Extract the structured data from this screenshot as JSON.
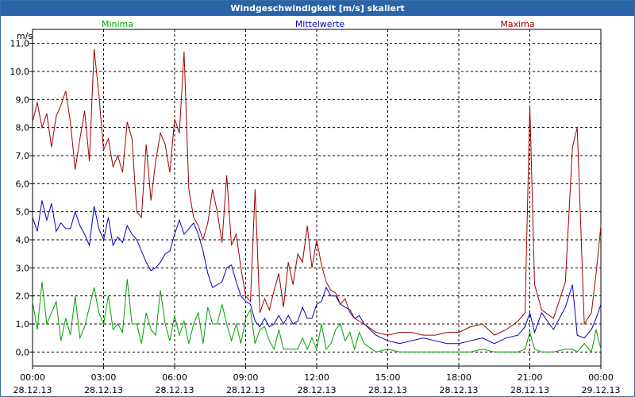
{
  "window": {
    "title": "Windgeschwindigkeit [m/s] skaliert"
  },
  "chart_data": {
    "type": "line",
    "title": "Windgeschwindigkeit [m/s] skaliert",
    "ylabel": "m/s",
    "xlabel": "",
    "ylim": [
      -0.5,
      11.5
    ],
    "xlim": [
      0,
      24
    ],
    "grid": true,
    "legend_position": "top",
    "y_ticks": [
      "0,0",
      "1,0",
      "2,0",
      "3,0",
      "4,0",
      "5,0",
      "6,0",
      "7,0",
      "8,0",
      "9,0",
      "10,0",
      "11,0"
    ],
    "x_ticks": [
      {
        "time": "00:00",
        "date": "28.12.13"
      },
      {
        "time": "03:00",
        "date": "28.12.13"
      },
      {
        "time": "06:00",
        "date": "28.12.13"
      },
      {
        "time": "09:00",
        "date": "28.12.13"
      },
      {
        "time": "12:00",
        "date": "28.12.13"
      },
      {
        "time": "15:00",
        "date": "28.12.13"
      },
      {
        "time": "18:00",
        "date": "28.12.13"
      },
      {
        "time": "21:00",
        "date": "28.12.13"
      },
      {
        "time": "00:00",
        "date": "29.12.13"
      }
    ],
    "series": [
      {
        "name": "Minima",
        "color": "#00a000",
        "x": [
          0,
          0.2,
          0.4,
          0.6,
          0.8,
          1.0,
          1.2,
          1.4,
          1.6,
          1.8,
          2.0,
          2.2,
          2.4,
          2.6,
          2.8,
          3.0,
          3.2,
          3.4,
          3.6,
          3.8,
          4.0,
          4.2,
          4.4,
          4.6,
          4.8,
          5.0,
          5.2,
          5.4,
          5.6,
          5.8,
          6.0,
          6.2,
          6.4,
          6.6,
          6.8,
          7.0,
          7.2,
          7.4,
          7.6,
          7.8,
          8.0,
          8.2,
          8.4,
          8.6,
          8.8,
          9.0,
          9.2,
          9.4,
          9.6,
          9.8,
          10.0,
          10.2,
          10.4,
          10.6,
          10.8,
          11.0,
          11.2,
          11.4,
          11.6,
          11.8,
          12.0,
          12.2,
          12.4,
          12.6,
          12.8,
          13.0,
          13.2,
          13.4,
          13.6,
          13.8,
          14.0,
          14.5,
          15.0,
          15.5,
          16.0,
          16.5,
          17.0,
          17.5,
          18.0,
          18.5,
          19.0,
          19.5,
          20.0,
          20.5,
          20.8,
          21.0,
          21.2,
          21.5,
          22.0,
          22.5,
          22.8,
          23.0,
          23.3,
          23.6,
          23.8,
          24.0
        ],
        "values": [
          1.8,
          0.8,
          2.5,
          1.0,
          1.4,
          1.8,
          0.4,
          1.2,
          0.6,
          2.0,
          0.5,
          0.9,
          1.6,
          2.3,
          1.4,
          1.0,
          2.0,
          0.8,
          1.0,
          0.7,
          2.6,
          1.0,
          1.0,
          0.3,
          1.4,
          0.8,
          0.6,
          2.2,
          1.0,
          0.4,
          1.3,
          0.6,
          1.1,
          0.3,
          1.0,
          1.4,
          0.3,
          1.6,
          1.0,
          1.0,
          1.7,
          1.0,
          0.4,
          1.0,
          0.3,
          1.2,
          1.5,
          0.3,
          0.8,
          0.9,
          0.4,
          0.1,
          0.8,
          0.1,
          0.1,
          0.1,
          0.1,
          0.5,
          0.1,
          0.5,
          0.1,
          1.0,
          0.1,
          0.3,
          0.8,
          1.0,
          0.4,
          0.7,
          0.1,
          0.7,
          0.3,
          0.0,
          0.1,
          0.0,
          0.0,
          0.0,
          0.0,
          0.0,
          0.0,
          0.0,
          0.1,
          0.0,
          0.0,
          0.0,
          0.1,
          0.7,
          0.1,
          0.0,
          0.0,
          0.1,
          0.1,
          0.0,
          0.3,
          0.0,
          0.8,
          0.1
        ]
      },
      {
        "name": "Mittelwerte",
        "color": "#0000c0",
        "x": [
          0,
          0.2,
          0.4,
          0.6,
          0.8,
          1.0,
          1.2,
          1.4,
          1.6,
          1.8,
          2.0,
          2.2,
          2.4,
          2.6,
          2.8,
          3.0,
          3.2,
          3.4,
          3.6,
          3.8,
          4.0,
          4.2,
          4.4,
          4.6,
          4.8,
          5.0,
          5.2,
          5.4,
          5.6,
          5.8,
          6.0,
          6.2,
          6.4,
          6.6,
          6.8,
          7.0,
          7.2,
          7.4,
          7.6,
          7.8,
          8.0,
          8.2,
          8.4,
          8.6,
          8.8,
          9.0,
          9.2,
          9.4,
          9.6,
          9.8,
          10.0,
          10.2,
          10.4,
          10.6,
          10.8,
          11.0,
          11.2,
          11.4,
          11.6,
          11.8,
          12.0,
          12.2,
          12.4,
          12.6,
          12.8,
          13.0,
          13.2,
          13.4,
          13.6,
          13.8,
          14.0,
          14.5,
          15.0,
          15.5,
          16.0,
          16.5,
          17.0,
          17.5,
          18.0,
          18.5,
          19.0,
          19.5,
          20.0,
          20.5,
          20.8,
          21.0,
          21.2,
          21.5,
          22.0,
          22.5,
          22.8,
          23.0,
          23.3,
          23.6,
          23.8,
          24.0
        ],
        "values": [
          4.8,
          4.3,
          5.4,
          4.7,
          5.3,
          4.3,
          4.6,
          4.4,
          4.4,
          5.0,
          4.5,
          4.2,
          3.8,
          5.2,
          4.4,
          4.0,
          4.8,
          3.8,
          4.1,
          3.9,
          4.5,
          4.2,
          4.0,
          3.6,
          3.2,
          2.9,
          3.0,
          3.2,
          3.5,
          3.6,
          4.2,
          4.7,
          4.2,
          4.4,
          4.6,
          4.2,
          3.6,
          2.8,
          2.3,
          2.4,
          2.5,
          3.0,
          3.1,
          2.5,
          2.0,
          1.8,
          1.7,
          1.1,
          0.9,
          1.2,
          0.9,
          1.0,
          1.3,
          1.0,
          1.3,
          1.0,
          1.1,
          1.6,
          1.2,
          1.2,
          1.7,
          1.8,
          2.3,
          2.0,
          2.0,
          1.7,
          1.6,
          1.5,
          1.2,
          1.3,
          1.0,
          0.6,
          0.4,
          0.3,
          0.4,
          0.5,
          0.4,
          0.3,
          0.3,
          0.4,
          0.5,
          0.3,
          0.5,
          0.6,
          0.9,
          1.4,
          0.7,
          1.4,
          0.8,
          1.6,
          2.4,
          0.6,
          0.5,
          0.8,
          1.2,
          1.7
        ]
      },
      {
        "name": "Maxima",
        "color": "#a00000",
        "x": [
          0,
          0.2,
          0.4,
          0.6,
          0.8,
          1.0,
          1.2,
          1.4,
          1.6,
          1.8,
          2.0,
          2.2,
          2.4,
          2.6,
          2.8,
          3.0,
          3.2,
          3.4,
          3.6,
          3.8,
          4.0,
          4.2,
          4.4,
          4.6,
          4.8,
          5.0,
          5.2,
          5.4,
          5.6,
          5.8,
          6.0,
          6.2,
          6.4,
          6.6,
          6.8,
          7.0,
          7.2,
          7.4,
          7.6,
          7.8,
          8.0,
          8.2,
          8.4,
          8.6,
          8.8,
          9.0,
          9.2,
          9.4,
          9.6,
          9.8,
          10.0,
          10.2,
          10.4,
          10.6,
          10.8,
          11.0,
          11.2,
          11.4,
          11.6,
          11.8,
          12.0,
          12.2,
          12.4,
          12.6,
          12.8,
          13.0,
          13.2,
          13.4,
          13.6,
          13.8,
          14.0,
          14.5,
          15.0,
          15.5,
          16.0,
          16.5,
          17.0,
          17.5,
          18.0,
          18.5,
          19.0,
          19.5,
          20.0,
          20.5,
          20.8,
          21.0,
          21.2,
          21.5,
          22.0,
          22.5,
          22.8,
          23.0,
          23.3,
          23.6,
          23.8,
          24.0
        ],
        "values": [
          8.2,
          8.9,
          8.0,
          8.5,
          7.3,
          8.4,
          8.8,
          9.3,
          8.2,
          6.5,
          7.6,
          8.6,
          6.8,
          10.8,
          9.2,
          7.2,
          7.6,
          6.6,
          7.0,
          6.4,
          8.2,
          7.6,
          5.0,
          4.8,
          7.4,
          5.4,
          6.8,
          7.8,
          7.4,
          6.4,
          8.3,
          7.8,
          10.7,
          5.8,
          4.8,
          4.5,
          4.0,
          4.6,
          5.8,
          5.0,
          3.9,
          6.3,
          3.8,
          4.2,
          3.0,
          2.0,
          1.8,
          5.8,
          1.4,
          1.9,
          1.5,
          2.2,
          2.8,
          1.6,
          3.2,
          2.4,
          3.5,
          3.2,
          4.5,
          3.0,
          4.0,
          3.1,
          2.5,
          2.2,
          2.1,
          1.7,
          1.9,
          1.4,
          1.2,
          1.1,
          1.0,
          0.7,
          0.6,
          0.7,
          0.7,
          0.6,
          0.6,
          0.7,
          0.7,
          0.9,
          1.0,
          0.6,
          0.8,
          1.1,
          1.4,
          8.8,
          2.4,
          1.5,
          1.2,
          2.5,
          7.3,
          8.0,
          1.0,
          1.4,
          2.8,
          4.5
        ]
      }
    ]
  }
}
